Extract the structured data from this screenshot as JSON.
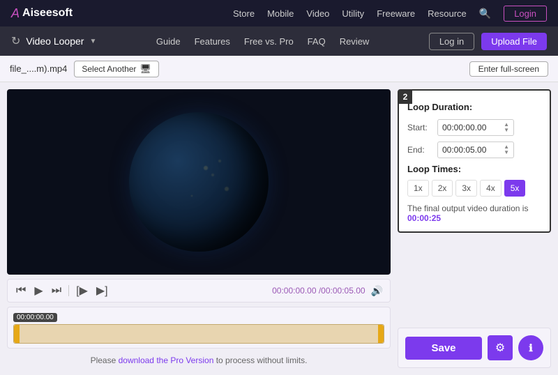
{
  "top_nav": {
    "logo": "Aiseesoft",
    "links": [
      "Store",
      "Mobile",
      "Video",
      "Utility",
      "Freeware",
      "Resource"
    ],
    "login_label": "Login"
  },
  "second_nav": {
    "loop_icon": "↻",
    "app_title": "Video Looper",
    "links": [
      "Guide",
      "Features",
      "Free vs. Pro",
      "FAQ",
      "Review"
    ],
    "login_label": "Log in",
    "upload_label": "Upload File"
  },
  "toolbar": {
    "file_name": "file_....m).mp4",
    "select_another_label": "Select Another",
    "fullscreen_label": "Enter full-screen"
  },
  "controls": {
    "time_display": "00:00:00.00 /00:00:05.00"
  },
  "timeline": {
    "time_label": "00:00:00.00"
  },
  "pro_notice": {
    "text_before": "Please ",
    "link_text": "download the Pro Version",
    "text_after": " to process without limits."
  },
  "loop_settings": {
    "box_number": "2",
    "loop_duration_title": "Loop Duration:",
    "start_label": "Start:",
    "start_value": "00:00:00.00",
    "end_label": "End:",
    "end_value": "00:00:05.00",
    "loop_times_title": "Loop Times:",
    "loop_times_options": [
      "1x",
      "2x",
      "3x",
      "4x",
      "5x"
    ],
    "active_option": "5x",
    "output_text": "The final output video duration is ",
    "output_duration": "00:00:25"
  },
  "save_area": {
    "save_label": "Save",
    "gear_icon": "⚙",
    "info_icon": "+"
  }
}
